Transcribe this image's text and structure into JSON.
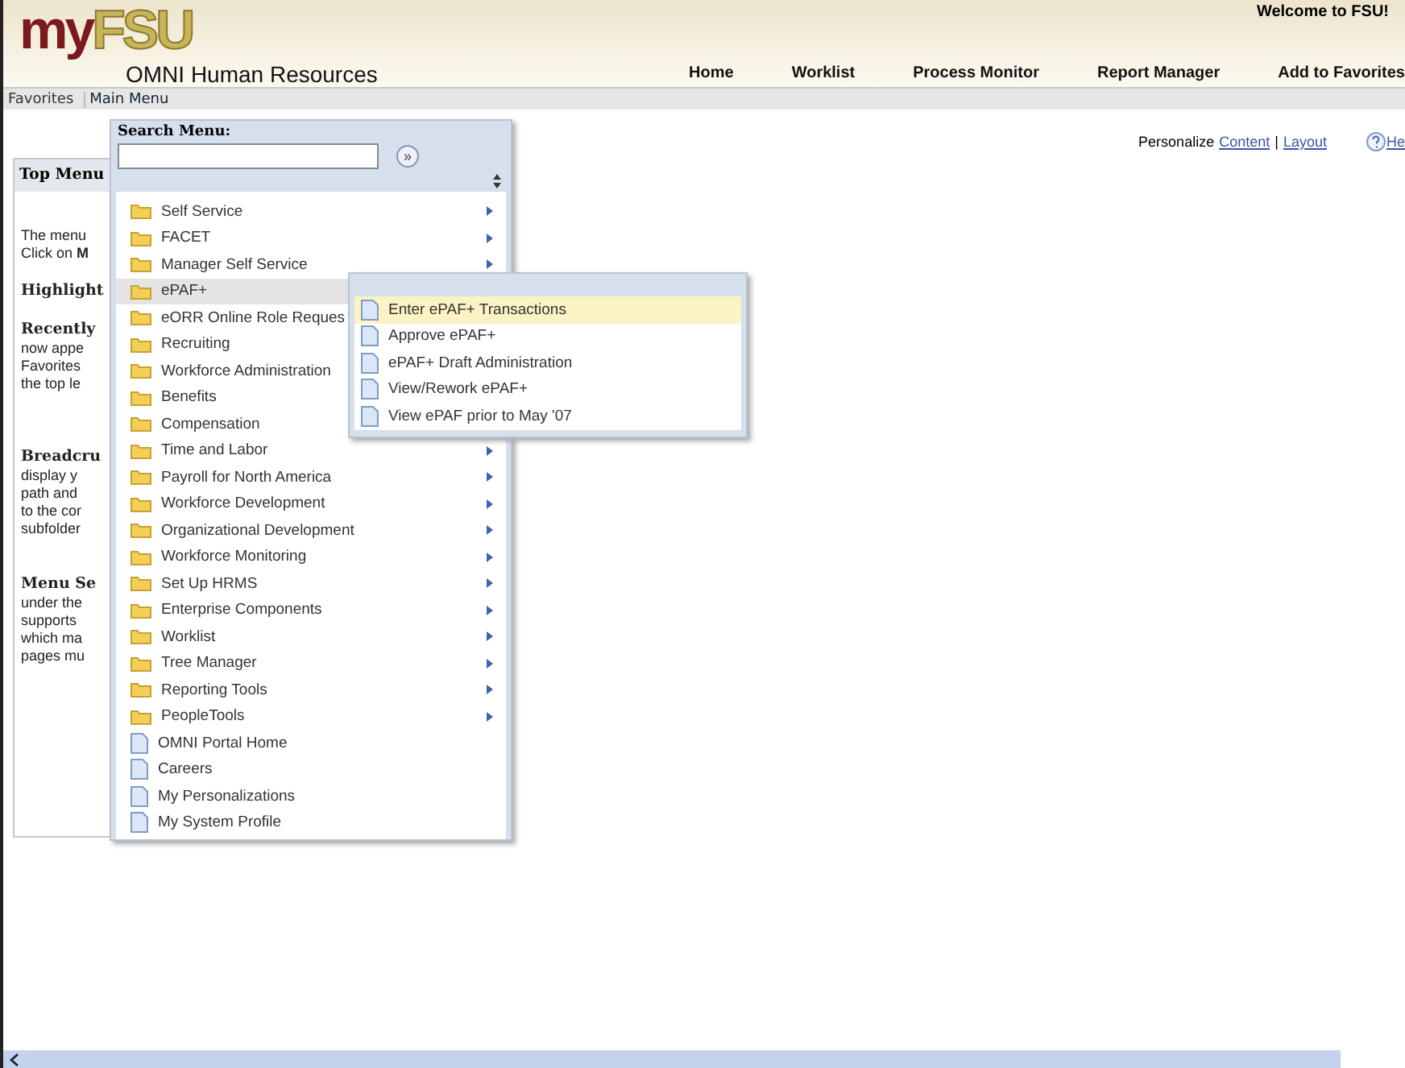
{
  "header": {
    "logo": {
      "part_1": "my",
      "part_2": "FSU"
    },
    "title": "OMNI Human Resources",
    "welcome": "Welcome to FSU!",
    "nav": [
      "Home",
      "Worklist",
      "Process Monitor",
      "Report Manager",
      "Add to Favorites"
    ]
  },
  "menubar": [
    {
      "label": "Favorites",
      "selected": false
    },
    {
      "label": "Main Menu",
      "selected": true
    }
  ],
  "personalize": {
    "label": "Personalize",
    "links": [
      "Content",
      "Layout"
    ],
    "separator": "|",
    "help": "He"
  },
  "pagelet": {
    "title": "Top Menu",
    "lines": [
      {
        "text": "The menu",
        "kind": "text"
      },
      {
        "text": "Click on **M**",
        "kind": "text"
      },
      {
        "kind": "gap"
      },
      {
        "text": "Highlight",
        "kind": "heading"
      },
      {
        "kind": "gap"
      },
      {
        "text": "Recently",
        "kind": "heading"
      },
      {
        "text": "now appe",
        "kind": "text"
      },
      {
        "text": "Favorites",
        "kind": "text"
      },
      {
        "text": "the top le",
        "kind": "text"
      },
      {
        "kind": "gap"
      },
      {
        "kind": "gap"
      },
      {
        "kind": "gap"
      },
      {
        "text": "Breadcru",
        "kind": "heading"
      },
      {
        "text": "display y",
        "kind": "text"
      },
      {
        "text": "path and",
        "kind": "text"
      },
      {
        "text": "to the cor",
        "kind": "text"
      },
      {
        "text": "subfolder",
        "kind": "text"
      },
      {
        "kind": "gap"
      },
      {
        "kind": "gap"
      },
      {
        "text": "Menu Se",
        "kind": "heading"
      },
      {
        "text": "under the",
        "kind": "text"
      },
      {
        "text": "supports",
        "kind": "text"
      },
      {
        "text": "which ma",
        "kind": "text"
      },
      {
        "text": "pages mu",
        "kind": "text"
      }
    ]
  },
  "main_menu": {
    "search_label": "Search Menu:",
    "go_button": "»",
    "items": [
      {
        "label": "Self Service",
        "kind": "folder",
        "selected": false
      },
      {
        "label": "FACET",
        "kind": "folder",
        "selected": false
      },
      {
        "label": "Manager Self Service",
        "kind": "folder",
        "selected": false
      },
      {
        "label": "ePAF+",
        "kind": "folder",
        "selected": true
      },
      {
        "label": "eORR Online Role Reques",
        "kind": "folder",
        "selected": false
      },
      {
        "label": "Recruiting",
        "kind": "folder",
        "selected": false
      },
      {
        "label": "Workforce Administration",
        "kind": "folder",
        "selected": false
      },
      {
        "label": "Benefits",
        "kind": "folder",
        "selected": false
      },
      {
        "label": "Compensation",
        "kind": "folder",
        "selected": false
      },
      {
        "label": "Time and Labor",
        "kind": "folder",
        "selected": false
      },
      {
        "label": "Payroll for North America",
        "kind": "folder",
        "selected": false
      },
      {
        "label": "Workforce Development",
        "kind": "folder",
        "selected": false
      },
      {
        "label": "Organizational Development",
        "kind": "folder",
        "selected": false
      },
      {
        "label": "Workforce Monitoring",
        "kind": "folder",
        "selected": false
      },
      {
        "label": "Set Up HRMS",
        "kind": "folder",
        "selected": false
      },
      {
        "label": "Enterprise Components",
        "kind": "folder",
        "selected": false
      },
      {
        "label": "Worklist",
        "kind": "folder",
        "selected": false
      },
      {
        "label": "Tree Manager",
        "kind": "folder",
        "selected": false
      },
      {
        "label": "Reporting Tools",
        "kind": "folder",
        "selected": false
      },
      {
        "label": "PeopleTools",
        "kind": "folder",
        "selected": false
      },
      {
        "label": "OMNI Portal Home",
        "kind": "page",
        "selected": false
      },
      {
        "label": "Careers",
        "kind": "page",
        "selected": false
      },
      {
        "label": "My Personalizations",
        "kind": "page",
        "selected": false
      },
      {
        "label": "My System Profile",
        "kind": "page",
        "selected": false
      }
    ]
  },
  "submenu": {
    "items": [
      {
        "label": "Enter ePAF+ Transactions",
        "selected": true
      },
      {
        "label": "Approve ePAF+",
        "selected": false
      },
      {
        "label": "ePAF+ Draft Administration",
        "selected": false
      },
      {
        "label": "View/Rework ePAF+",
        "selected": false
      },
      {
        "label": "View ePAF prior to May '07",
        "selected": false
      }
    ]
  }
}
